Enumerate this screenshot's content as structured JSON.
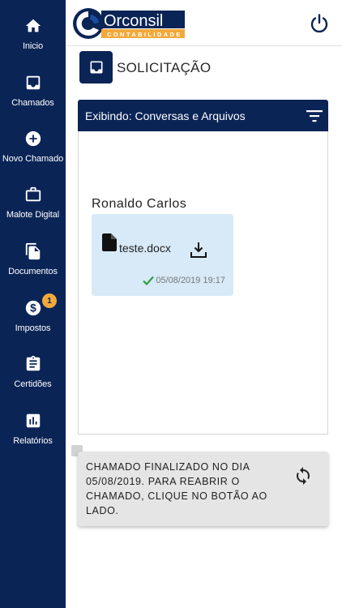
{
  "sidebar": {
    "items": [
      {
        "label": "Inicio",
        "icon": "home-icon"
      },
      {
        "label": "Chamados",
        "icon": "inbox-icon"
      },
      {
        "label": "Novo Chamado",
        "icon": "add-circle-icon"
      },
      {
        "label": "Malote Digital",
        "icon": "briefcase-icon"
      },
      {
        "label": "Documentos",
        "icon": "documents-icon"
      },
      {
        "label": "Impostos",
        "icon": "dollar-icon",
        "badge": "1"
      },
      {
        "label": "Certidões",
        "icon": "clipboard-icon"
      },
      {
        "label": "Relatórios",
        "icon": "chart-icon"
      }
    ]
  },
  "header": {
    "logo_text": "Orconsil",
    "logo_subtext": "CONTABILIDADE"
  },
  "page": {
    "title": "SOLICITAÇÃO",
    "filter_label": "Exibindo: Conversas e Arquivos"
  },
  "message": {
    "sender": "Ronaldo Carlos",
    "file_name": "teste.docx",
    "timestamp": "05/08/2019 19:17"
  },
  "notice": {
    "text": "CHAMADO FINALIZADO NO DIA 05/08/2019. PARA REABRIR O CHAMADO, CLIQUE NO BOTÃO AO LADO."
  },
  "colors": {
    "primary": "#0a2456",
    "accent": "#f2a93b",
    "card_bg": "#d8e9f7",
    "check": "#2e9e3e"
  }
}
